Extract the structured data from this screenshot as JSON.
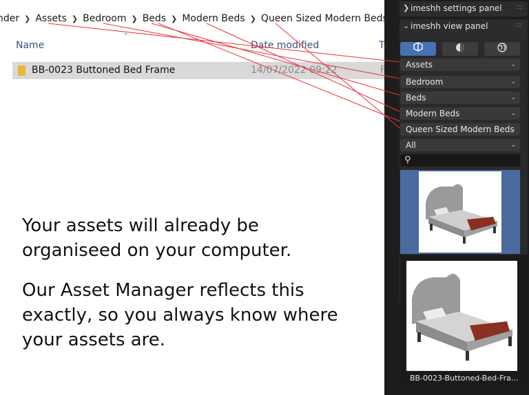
{
  "explorer": {
    "breadcrumb": [
      "nder",
      "Assets",
      "Bedroom",
      "Beds",
      "Modern Beds",
      "Queen Sized Modern Beds"
    ],
    "columns": {
      "name": "Name",
      "date": "Date modified",
      "type": "T"
    },
    "file": {
      "name": "BB-0023 Buttoned Bed Frame",
      "date": "14/07/2022 09:22",
      "type": "F"
    }
  },
  "message": {
    "line1": "Your assets will already be organiseed on your computer.",
    "line2": "Our Asset Manager reflects this exactly, so you always know where your assets are."
  },
  "panel": {
    "settings_title": "imeshh settings panel",
    "view_title": "imeshh view panel",
    "icon_buttons": [
      "model-icon",
      "material-icon",
      "world-icon"
    ],
    "dropdowns": [
      "Assets",
      "Bedroom",
      "Beds",
      "Modern Beds",
      "Queen Sized Modern Beds",
      "All"
    ],
    "search_placeholder": "",
    "asset_caption": "BB-0023-Buttoned-Bed-Fra..."
  },
  "colors": {
    "accent": "#4772b3",
    "annotation": "#e8333a",
    "folder": "#e8b931"
  }
}
